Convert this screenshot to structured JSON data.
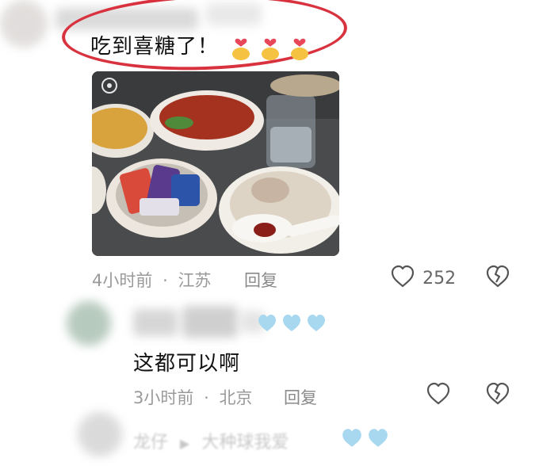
{
  "comment1": {
    "text": "吃到喜糖了！",
    "time": "4小时前",
    "location": "江苏",
    "reply_label": "回复",
    "like_count": "252"
  },
  "reply1": {
    "text": "这都可以啊",
    "time": "3小时前",
    "location": "北京",
    "reply_label": "回复"
  },
  "reply2": {
    "author": "龙仔",
    "reply_to": "大种球我爱"
  },
  "separator": "·",
  "colors": {
    "annotation_red": "#d9323f",
    "meta_gray": "#9a9a9a",
    "blue_heart": "#a8d8f0"
  },
  "icons": [
    "heart-outline-icon",
    "broken-heart-icon",
    "hands-heart-emoji",
    "blue-heart-emoji",
    "blurred-avatar"
  ]
}
